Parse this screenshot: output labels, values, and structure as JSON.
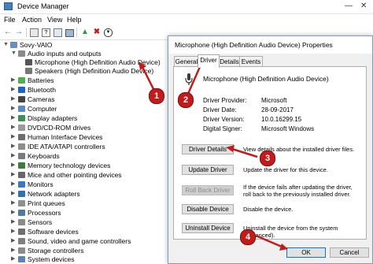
{
  "window": {
    "title": "Device Manager"
  },
  "menu": {
    "items": [
      "File",
      "Action",
      "View",
      "Help"
    ]
  },
  "tree": {
    "root": "Sovy-VAIO",
    "items": [
      {
        "label": "Audio inputs and outputs",
        "expanded": true,
        "icon": "speaker-icon"
      },
      {
        "label": "Microphone (High Definition Audio Device)",
        "child": true,
        "icon": "microphone-icon"
      },
      {
        "label": "Speakers (High Definition Audio Device)",
        "child": true,
        "icon": "speaker-icon"
      },
      {
        "label": "Batteries",
        "icon": "battery-icon"
      },
      {
        "label": "Bluetooth",
        "icon": "bluetooth-icon"
      },
      {
        "label": "Cameras",
        "icon": "camera-icon"
      },
      {
        "label": "Computer",
        "icon": "computer-icon"
      },
      {
        "label": "Display adapters",
        "icon": "display-icon"
      },
      {
        "label": "DVD/CD-ROM drives",
        "icon": "disc-icon"
      },
      {
        "label": "Human Interface Devices",
        "icon": "hid-icon"
      },
      {
        "label": "IDE ATA/ATAPI controllers",
        "icon": "controller-icon"
      },
      {
        "label": "Keyboards",
        "icon": "keyboard-icon"
      },
      {
        "label": "Memory technology devices",
        "icon": "memory-icon"
      },
      {
        "label": "Mice and other pointing devices",
        "icon": "mouse-icon"
      },
      {
        "label": "Monitors",
        "icon": "monitor-icon"
      },
      {
        "label": "Network adapters",
        "icon": "network-icon"
      },
      {
        "label": "Print queues",
        "icon": "printer-icon"
      },
      {
        "label": "Processors",
        "icon": "processor-icon"
      },
      {
        "label": "Sensors",
        "icon": "sensor-icon"
      },
      {
        "label": "Software devices",
        "icon": "software-icon"
      },
      {
        "label": "Sound, video and game controllers",
        "icon": "sound-icon"
      },
      {
        "label": "Storage controllers",
        "icon": "storage-icon"
      },
      {
        "label": "System devices",
        "icon": "system-icon"
      },
      {
        "label": "Universal Serial Bus controllers",
        "icon": "usb-icon"
      }
    ]
  },
  "dialog": {
    "title": "Microphone (High Definition Audio Device) Properties",
    "tabs": [
      "General",
      "Driver",
      "Details",
      "Events"
    ],
    "active_tab": "Driver",
    "device_name": "Microphone (High Definition Audio Device)",
    "fields": [
      {
        "label": "Driver Provider:",
        "value": "Microsoft"
      },
      {
        "label": "Driver Date:",
        "value": "28-09-2017"
      },
      {
        "label": "Driver Version:",
        "value": "10.0.16299.15"
      },
      {
        "label": "Digital Signer:",
        "value": "Microsoft Windows"
      }
    ],
    "buttons": [
      {
        "label": "Driver Details",
        "desc": "View details about the installed driver files.",
        "enabled": true
      },
      {
        "label": "Update Driver",
        "desc": "Update the driver for this device.",
        "enabled": true
      },
      {
        "label": "Roll Back Driver",
        "desc": "If the device fails after updating the driver, roll back to the previously installed driver.",
        "enabled": false
      },
      {
        "label": "Disable Device",
        "desc": "Disable the device.",
        "enabled": true
      },
      {
        "label": "Uninstall Device",
        "desc": "Uninstall the device from the system (Advanced).",
        "enabled": true
      }
    ],
    "ok_label": "OK",
    "cancel_label": "Cancel"
  },
  "callouts": [
    "1",
    "2",
    "3",
    "4"
  ],
  "colors": {
    "callout": "#c21b1b",
    "selection": "#cce8ff",
    "dialog_border": "#7a9cc6"
  }
}
